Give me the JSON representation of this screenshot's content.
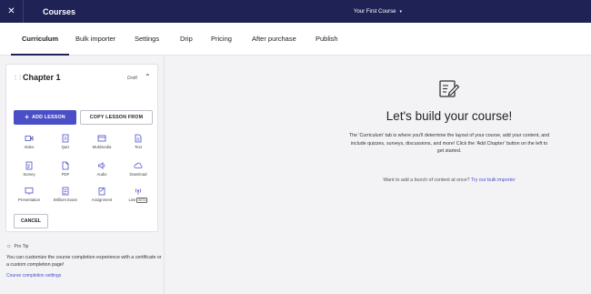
{
  "topbar": {
    "close_icon": "close-icon",
    "title": "Courses",
    "course_name": "Your First Course",
    "caret": "▾"
  },
  "tabs": [
    {
      "label": "Curriculum",
      "active": true
    },
    {
      "label": "Bulk importer"
    },
    {
      "label": "Settings"
    },
    {
      "label": "Drip"
    },
    {
      "label": "Pricing"
    },
    {
      "label": "After purchase"
    },
    {
      "label": "Publish"
    }
  ],
  "chapter": {
    "title": "Chapter 1",
    "status": "Draft",
    "add_lesson_label": "ADD LESSON",
    "copy_lesson_label": "COPY LESSON FROM",
    "cancel_label": "CANCEL",
    "lesson_types": [
      {
        "label": "Video",
        "icon": "video-icon"
      },
      {
        "label": "Quiz",
        "icon": "quiz-icon"
      },
      {
        "label": "Multimedia",
        "icon": "multimedia-icon"
      },
      {
        "label": "Text",
        "icon": "text-icon"
      },
      {
        "label": "Survey",
        "icon": "survey-icon"
      },
      {
        "label": "PDF",
        "icon": "pdf-icon"
      },
      {
        "label": "Audio",
        "icon": "audio-icon"
      },
      {
        "label": "Download",
        "icon": "download-icon"
      },
      {
        "label": "Presentation",
        "icon": "presentation-icon"
      },
      {
        "label": "Brillium Exam",
        "icon": "exam-icon"
      },
      {
        "label": "Assignment",
        "icon": "assignment-icon"
      },
      {
        "label": "Live",
        "icon": "live-icon",
        "badge": "BETA"
      }
    ]
  },
  "protip": {
    "heading": "Pro Tip",
    "body": "You can customize the course completion experience with a certificate or a custom completion page!",
    "link": "Course completion settings"
  },
  "empty_state": {
    "heading": "Let's build your course!",
    "description": "The 'Curriculum' tab is where you'll determine the layout of your course, add your content, and include quizzes, surveys, discussions, and more! Click the 'Add Chapter' button on the left to get started.",
    "importer_prompt": "Want to add a bunch of content at once?",
    "importer_link": "Try our bulk importer"
  },
  "colors": {
    "header_bg": "#1f2255",
    "accent": "#4a4fc6"
  }
}
